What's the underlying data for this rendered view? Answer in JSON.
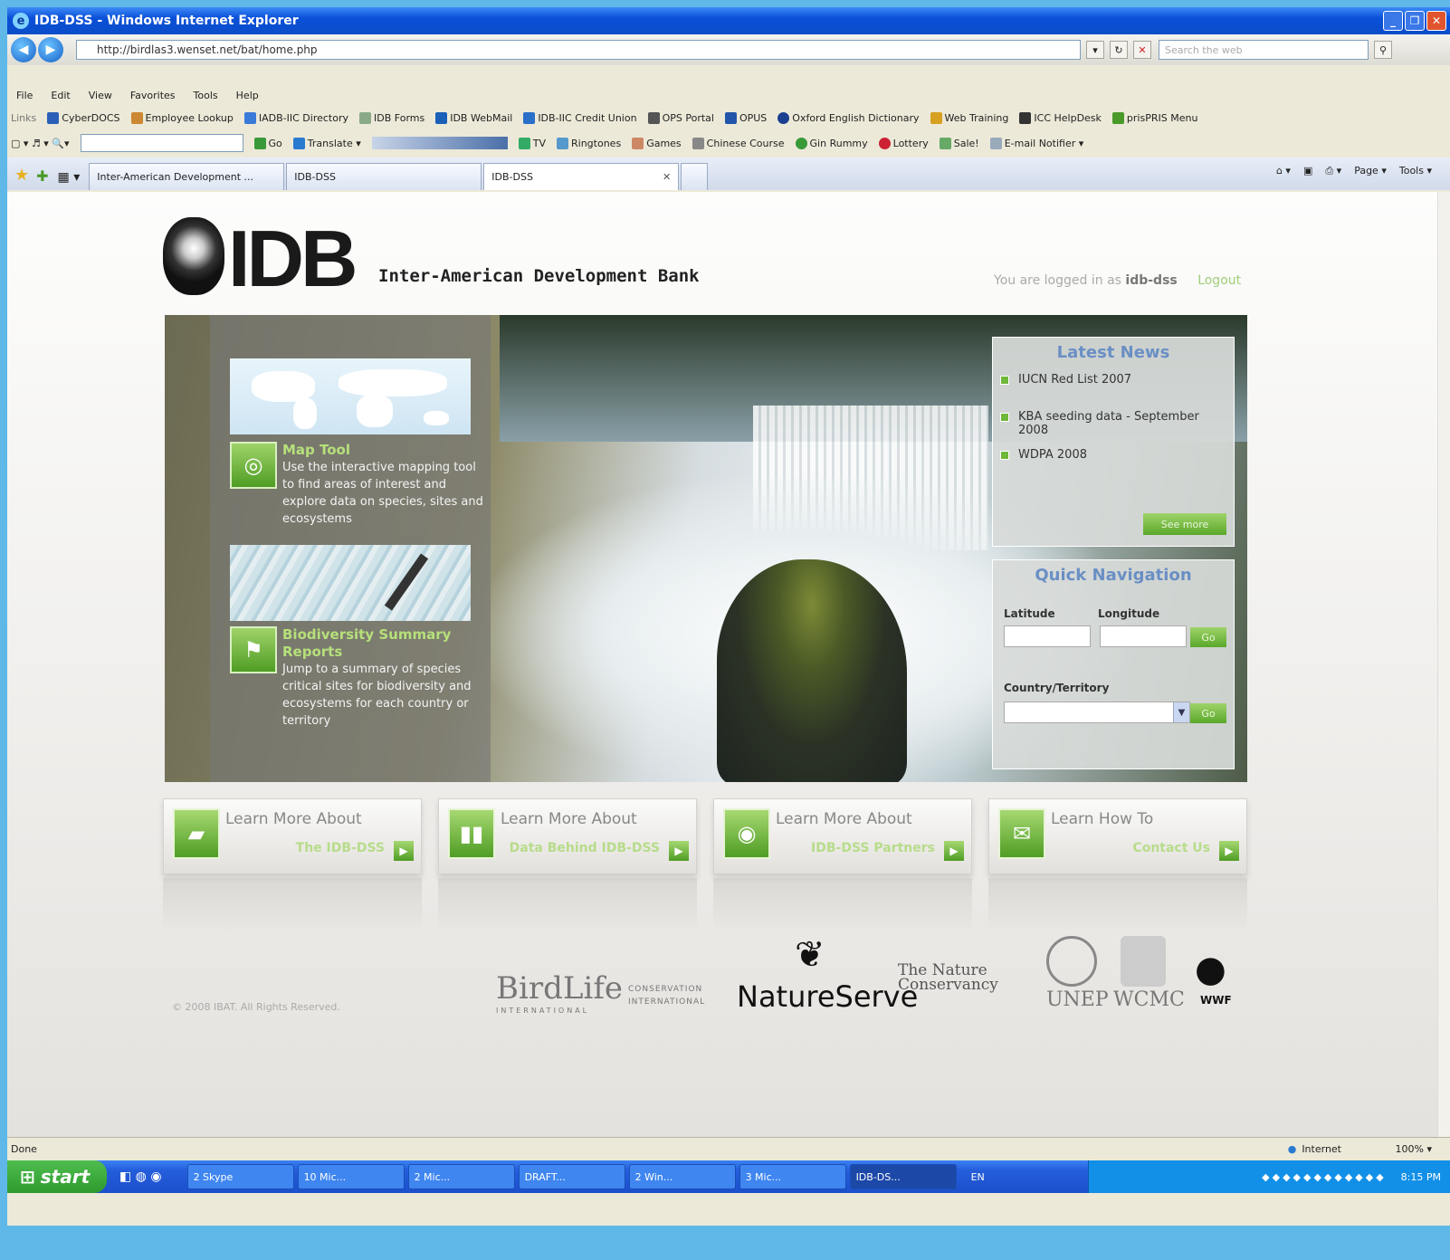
{
  "window": {
    "title": "IDB-DSS - Windows Internet Explorer"
  },
  "address": {
    "url": "http://birdlas3.wenset.net/bat/home.php",
    "search_placeholder": "Search the web"
  },
  "menu": [
    "File",
    "Edit",
    "View",
    "Favorites",
    "Tools",
    "Help"
  ],
  "links": {
    "label": "Links",
    "items": [
      "CyberDOCS",
      "Employee Lookup",
      "IADB-IIC Directory",
      "IDB Forms",
      "IDB WebMail",
      "IDB-IIC Credit Union",
      "OPS Portal",
      "OPUS",
      "Oxford English Dictionary",
      "Web Training",
      "ICC HelpDesk",
      "prisPRIS Menu"
    ]
  },
  "toolbar2": {
    "go": "Go",
    "translate": "Translate",
    "items": [
      "TV",
      "Ringtones",
      "Games",
      "Chinese Course",
      "Gin Rummy",
      "Lottery",
      "Sale!",
      "E-mail Notifier"
    ]
  },
  "tabs": [
    {
      "label": "Inter-American Development ..."
    },
    {
      "label": "IDB-DSS"
    },
    {
      "label": "IDB-DSS"
    }
  ],
  "commands": [
    "Page",
    "Tools"
  ],
  "page": {
    "brand": {
      "logo_text": "IDB",
      "bank_name": "Inter-American Development Bank"
    },
    "login": {
      "prefix": "You are logged in as",
      "user": "idb-dss",
      "logout": "Logout"
    },
    "features": [
      {
        "title": "Map Tool",
        "desc": "Use the interactive mapping tool to find areas of interest and explore data on species, sites and ecosystems"
      },
      {
        "title": "Biodiversity Summary Reports",
        "desc": "Jump to a summary of species critical sites for biodiversity and ecosystems for each country or territory"
      }
    ],
    "news": {
      "title": "Latest News",
      "items": [
        "IUCN Red List 2007",
        "KBA seeding data - September 2008",
        "WDPA 2008"
      ],
      "see_more": "See more"
    },
    "quick_nav": {
      "title": "Quick Navigation",
      "latitude": "Latitude",
      "longitude": "Longitude",
      "go": "Go",
      "country": "Country/Territory"
    },
    "cards": [
      {
        "title": "Learn More About",
        "sub": "The IDB-DSS"
      },
      {
        "title": "Learn More About",
        "sub": "Data Behind IDB-DSS"
      },
      {
        "title": "Learn More About",
        "sub": "IDB-DSS Partners"
      },
      {
        "title": "Learn How To",
        "sub": "Contact Us"
      }
    ],
    "copyright": "© 2008 IBAT. All Rights Reserved.",
    "partners": [
      "BirdLife",
      "INTERNATIONAL",
      "CONSERVATION",
      "INTERNATIONAL",
      "NatureServe",
      "The Nature Conservancy",
      "UNEP",
      "WCMC",
      "WWF"
    ]
  },
  "status": {
    "left": "Done",
    "zone": "Internet",
    "zoom": "100%"
  },
  "taskbar": {
    "start": "start",
    "tasks": [
      "2 Skype",
      "10 Mic...",
      "2 Mic...",
      "DRAFT...",
      "2 Win...",
      "3 Mic...",
      "IDB-DS..."
    ],
    "lang": "EN",
    "time": "8:15 PM"
  }
}
